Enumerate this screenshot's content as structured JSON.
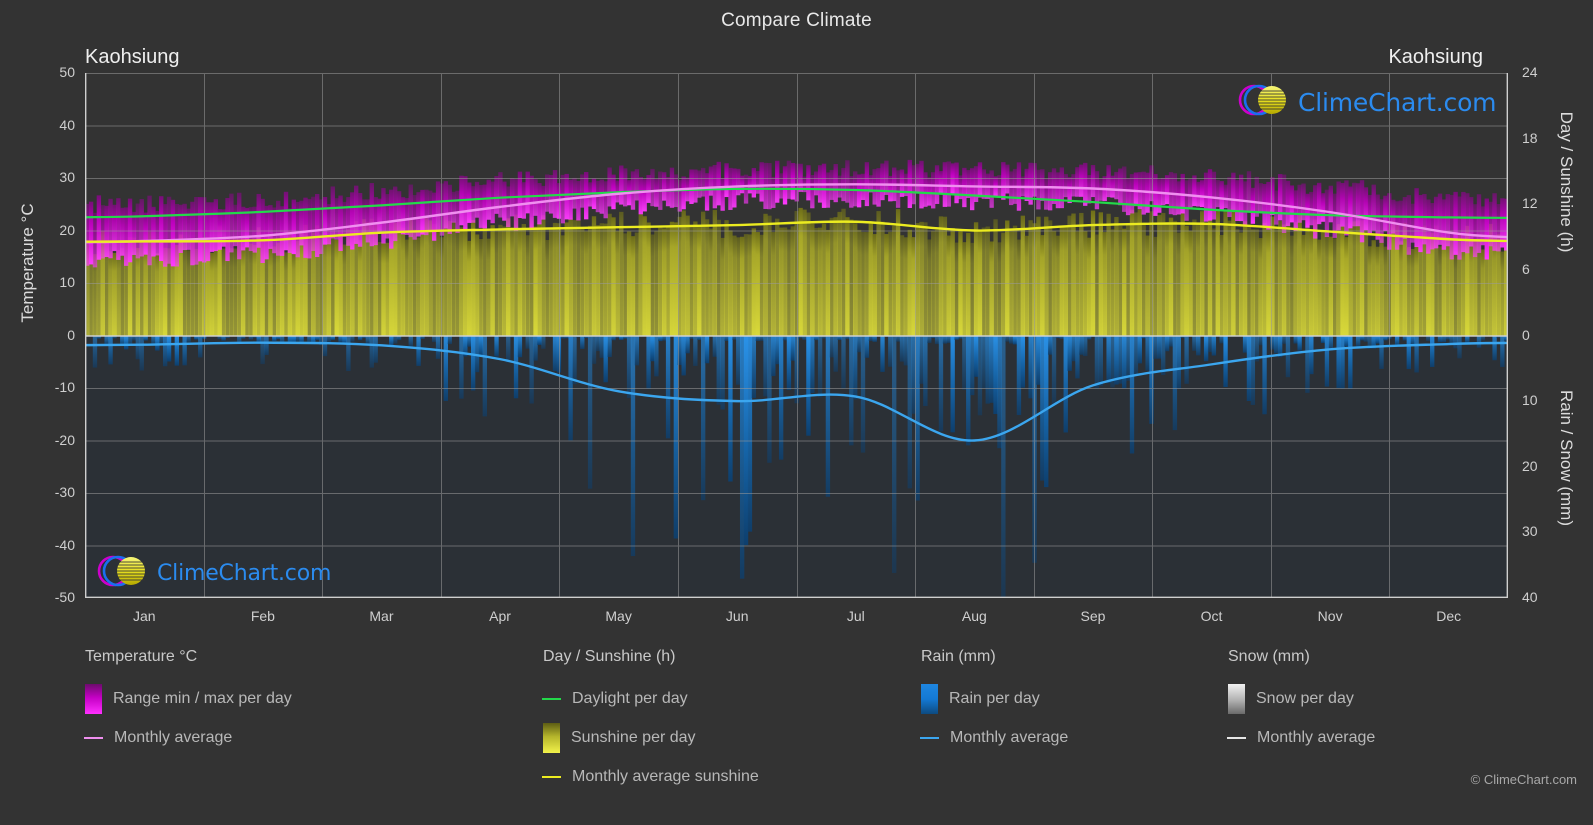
{
  "title": "Compare Climate",
  "station_left": "Kaohsiung",
  "station_right": "Kaohsiung",
  "copyright": "© ClimeChart.com",
  "watermark": {
    "text": "ClimeChart.com"
  },
  "axes": {
    "left_title": "Temperature °C",
    "right_title_top": "Day / Sunshine (h)",
    "right_title_bottom": "Rain / Snow (mm)",
    "left_ticks": [
      "50",
      "40",
      "30",
      "20",
      "10",
      "0",
      "-10",
      "-20",
      "-30",
      "-40",
      "-50"
    ],
    "right_ticks_top": [
      "24",
      "18",
      "12",
      "6",
      "0"
    ],
    "right_ticks_bottom": [
      "10",
      "20",
      "30",
      "40"
    ],
    "months": [
      "Jan",
      "Feb",
      "Mar",
      "Apr",
      "May",
      "Jun",
      "Jul",
      "Aug",
      "Sep",
      "Oct",
      "Nov",
      "Dec"
    ]
  },
  "legend": {
    "groups": [
      {
        "heading": "Temperature °C",
        "items": [
          {
            "label": "Range min / max per day",
            "marker": "swatch",
            "swatch": "sw-temp",
            "color": "#e000e0"
          },
          {
            "label": "Monthly average",
            "marker": "line",
            "color": "#ef8fef"
          }
        ]
      },
      {
        "heading": "Day / Sunshine (h)",
        "items": [
          {
            "label": "Daylight per day",
            "marker": "line",
            "color": "#23d94a"
          },
          {
            "label": "Sunshine per day",
            "marker": "swatch",
            "swatch": "sw-sun",
            "color": "#dede3c"
          },
          {
            "label": "Monthly average sunshine",
            "marker": "line",
            "color": "#ecec20"
          }
        ]
      },
      {
        "heading": "Rain (mm)",
        "items": [
          {
            "label": "Rain per day",
            "marker": "swatch",
            "swatch": "sw-rain",
            "color": "#1e86e0"
          },
          {
            "label": "Monthly average",
            "marker": "line",
            "color": "#3ba6ef"
          }
        ]
      },
      {
        "heading": "Snow (mm)",
        "items": [
          {
            "label": "Snow per day",
            "marker": "swatch",
            "swatch": "sw-snow",
            "color": "#d8d8d8"
          },
          {
            "label": "Monthly average",
            "marker": "line",
            "color": "#e6e6e6"
          }
        ]
      }
    ]
  },
  "colors": {
    "background": "#333333",
    "grid": "#9a9a9a",
    "temp_range": "#c400c4",
    "temp_avg": "#f08ff0",
    "daylight": "#23d94a",
    "sunshine_band": "#b5b52b",
    "sunshine_avg": "#ecec20",
    "rain_band": "#1b7cc9",
    "rain_avg": "#3ba6ef",
    "text": "#d0d0d0"
  },
  "chart_data": {
    "type": "area",
    "title": "Compare Climate",
    "subtitle": "Kaohsiung",
    "xlabel": "",
    "ylabel": "Temperature °C",
    "ylim": [
      -50,
      50
    ],
    "y2lim_top": [
      0,
      24
    ],
    "y2lim_bottom": [
      0,
      40
    ],
    "grid": true,
    "legend_position": "bottom",
    "categories": [
      "Jan",
      "Feb",
      "Mar",
      "Apr",
      "May",
      "Jun",
      "Jul",
      "Aug",
      "Sep",
      "Oct",
      "Nov",
      "Dec"
    ],
    "series": [
      {
        "name": "Monthly average temperature (°C)",
        "unit": "°C",
        "color": "#f08ff0",
        "values": [
          18.0,
          19.0,
          21.5,
          24.5,
          27.0,
          28.4,
          28.8,
          28.4,
          28.0,
          26.3,
          23.5,
          19.6
        ]
      },
      {
        "name": "Range max per day (°C)",
        "unit": "°C",
        "color": "#c400c4",
        "values": [
          25.0,
          25.6,
          27.5,
          29.5,
          31.0,
          31.5,
          32.0,
          31.5,
          31.3,
          30.3,
          28.5,
          26.0
        ]
      },
      {
        "name": "Range min per day (°C)",
        "unit": "°C",
        "color": "#c400c4",
        "values": [
          14.5,
          15.5,
          18.0,
          21.5,
          24.0,
          25.5,
          25.8,
          25.5,
          25.0,
          23.0,
          20.0,
          16.0
        ]
      },
      {
        "name": "Daylight per day (h)",
        "unit": "h",
        "color": "#23d94a",
        "values": [
          10.9,
          11.3,
          11.9,
          12.6,
          13.1,
          13.4,
          13.3,
          12.8,
          12.2,
          11.5,
          11.0,
          10.8
        ]
      },
      {
        "name": "Monthly average sunshine (h)",
        "unit": "h",
        "color": "#ecec20",
        "values": [
          8.6,
          8.7,
          9.4,
          9.7,
          9.9,
          10.1,
          10.4,
          9.6,
          10.1,
          10.2,
          9.5,
          8.8
        ]
      },
      {
        "name": "Monthly average rain (mm)",
        "unit": "mm",
        "color": "#3ba6ef",
        "values": [
          1.4,
          1.1,
          1.5,
          3.6,
          8.5,
          10.0,
          9.3,
          16.0,
          7.6,
          4.4,
          2.1,
          1.3
        ]
      },
      {
        "name": "Monthly average snow (mm)",
        "unit": "mm",
        "color": "#e6e6e6",
        "values": [
          0,
          0,
          0,
          0,
          0,
          0,
          0,
          0,
          0,
          0,
          0,
          0
        ]
      }
    ]
  }
}
